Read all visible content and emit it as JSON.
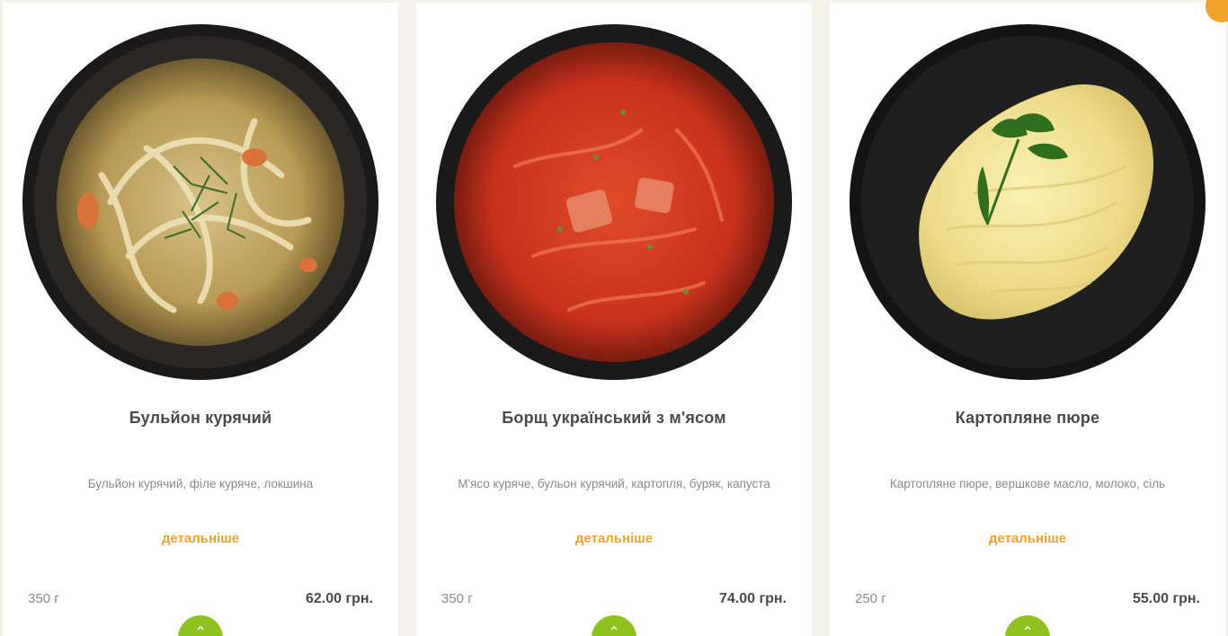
{
  "colors": {
    "accent": "#f0a22b",
    "add_button": "#8dc21f",
    "title": "#4a4a4a",
    "muted": "#8a8a8a",
    "background": "#f3f3ec"
  },
  "products": [
    {
      "title": "Бульйон курячий",
      "ingredients": "Бульйон курячий, філе куряче, локшина",
      "details_label": "детальніше",
      "weight": "350 г",
      "price": "62.00 грн.",
      "image_icon": "chicken-broth-bowl-image"
    },
    {
      "title": "Борщ український з м'ясом",
      "ingredients": "М'ясо куряче, бульон курячий, картопля, буряк, капуста",
      "details_label": "детальніше",
      "weight": "350 г",
      "price": "74.00 грн.",
      "image_icon": "borscht-bowl-image"
    },
    {
      "title": "Картопляне пюре",
      "ingredients": "Картопляне пюре, вершкове масло, молоко, сіль",
      "details_label": "детальніше",
      "weight": "250 г",
      "price": "55.00 грн.",
      "image_icon": "mashed-potatoes-plate-image"
    }
  ]
}
